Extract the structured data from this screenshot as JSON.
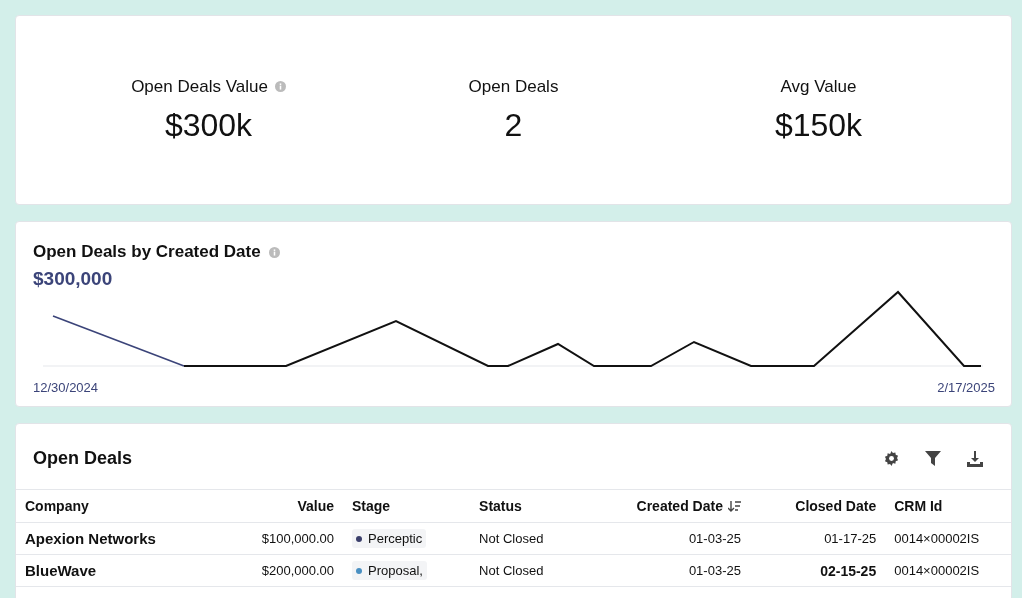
{
  "kpis": [
    {
      "label": "Open Deals Value",
      "value": "$300k",
      "info": true
    },
    {
      "label": "Open Deals",
      "value": "2",
      "info": false
    },
    {
      "label": "Avg Value",
      "value": "$150k",
      "info": false
    }
  ],
  "trend": {
    "title": "Open Deals by Created Date",
    "total": "$300,000",
    "start_date": "12/30/2024",
    "end_date": "2/17/2025"
  },
  "table": {
    "title": "Open Deals",
    "columns": [
      {
        "label": "Company",
        "sorted": false
      },
      {
        "label": "Value",
        "sorted": false
      },
      {
        "label": "Stage",
        "sorted": false
      },
      {
        "label": "Status",
        "sorted": false
      },
      {
        "label": "Created Date",
        "sorted": true
      },
      {
        "label": "Closed Date",
        "sorted": false
      },
      {
        "label": "CRM Id",
        "sorted": false
      }
    ],
    "rows": [
      {
        "company": "Apexion Networks",
        "value": "$100,000.00",
        "stage": "Perceptic",
        "color": "#3b3f6b",
        "status": "Not Closed",
        "created": "01-03-25",
        "closed": "01-17-25",
        "closed_bold": false,
        "crm_id": "0014×00002IS"
      },
      {
        "company": "BlueWave",
        "value": "$200,000.00",
        "stage": "Proposal,",
        "color": "#4a90c2",
        "status": "Not Closed",
        "created": "01-03-25",
        "closed": "02-15-25",
        "closed_bold": true,
        "crm_id": "0014×00002IS"
      }
    ]
  }
}
